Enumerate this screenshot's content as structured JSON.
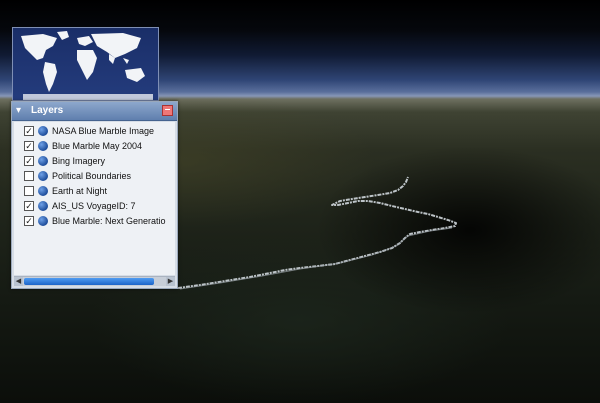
{
  "layers_panel": {
    "title": "Layers",
    "items": [
      {
        "label": "NASA Blue Marble Image",
        "checked": true
      },
      {
        "label": "Blue Marble May 2004",
        "checked": true
      },
      {
        "label": "Bing Imagery",
        "checked": true
      },
      {
        "label": "Political Boundaries",
        "checked": false
      },
      {
        "label": "Earth at Night",
        "checked": false
      },
      {
        "label": "AIS_US VoyageID: 7",
        "checked": true
      },
      {
        "label": "Blue Marble: Next Generatio",
        "checked": true
      }
    ]
  },
  "icons": {
    "title": "layers-icon",
    "close": "close-icon",
    "layer": "globe-icon",
    "scroll_left": "arrow-left-icon",
    "scroll_right": "arrow-right-icon"
  },
  "colors": {
    "title_bar": "#6f8dbb",
    "panel_bg": "#d6dde6",
    "close_button": "#e77777",
    "scroll_thumb": "#2f7be0",
    "track_line": "#cfd6dc"
  }
}
